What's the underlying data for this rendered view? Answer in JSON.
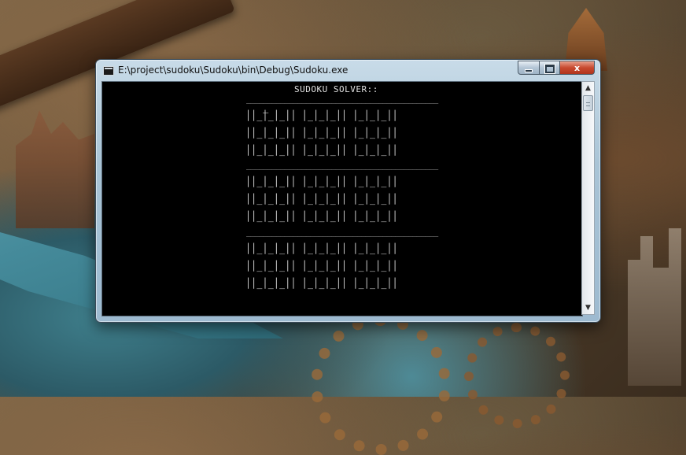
{
  "window": {
    "title": "E:\\project\\sudoku\\Sudoku\\bin\\Debug\\Sudoku.exe",
    "controls": {
      "minimize": "minimize",
      "maximize": "maximize",
      "close": "x"
    }
  },
  "console": {
    "heading": "SUDOKU SOLVER::",
    "separator": "_____________________________________________",
    "band_rows": [
      "||_|_|_|| |_|_|_|| |_|_|_||",
      "||_|_|_|| |_|_|_|| |_|_|_||",
      "||_|_|_|| |_|_|_|| |_|_|_||"
    ],
    "cursor": "_"
  },
  "scrollbar": {
    "up": "▲",
    "down": "▼"
  }
}
